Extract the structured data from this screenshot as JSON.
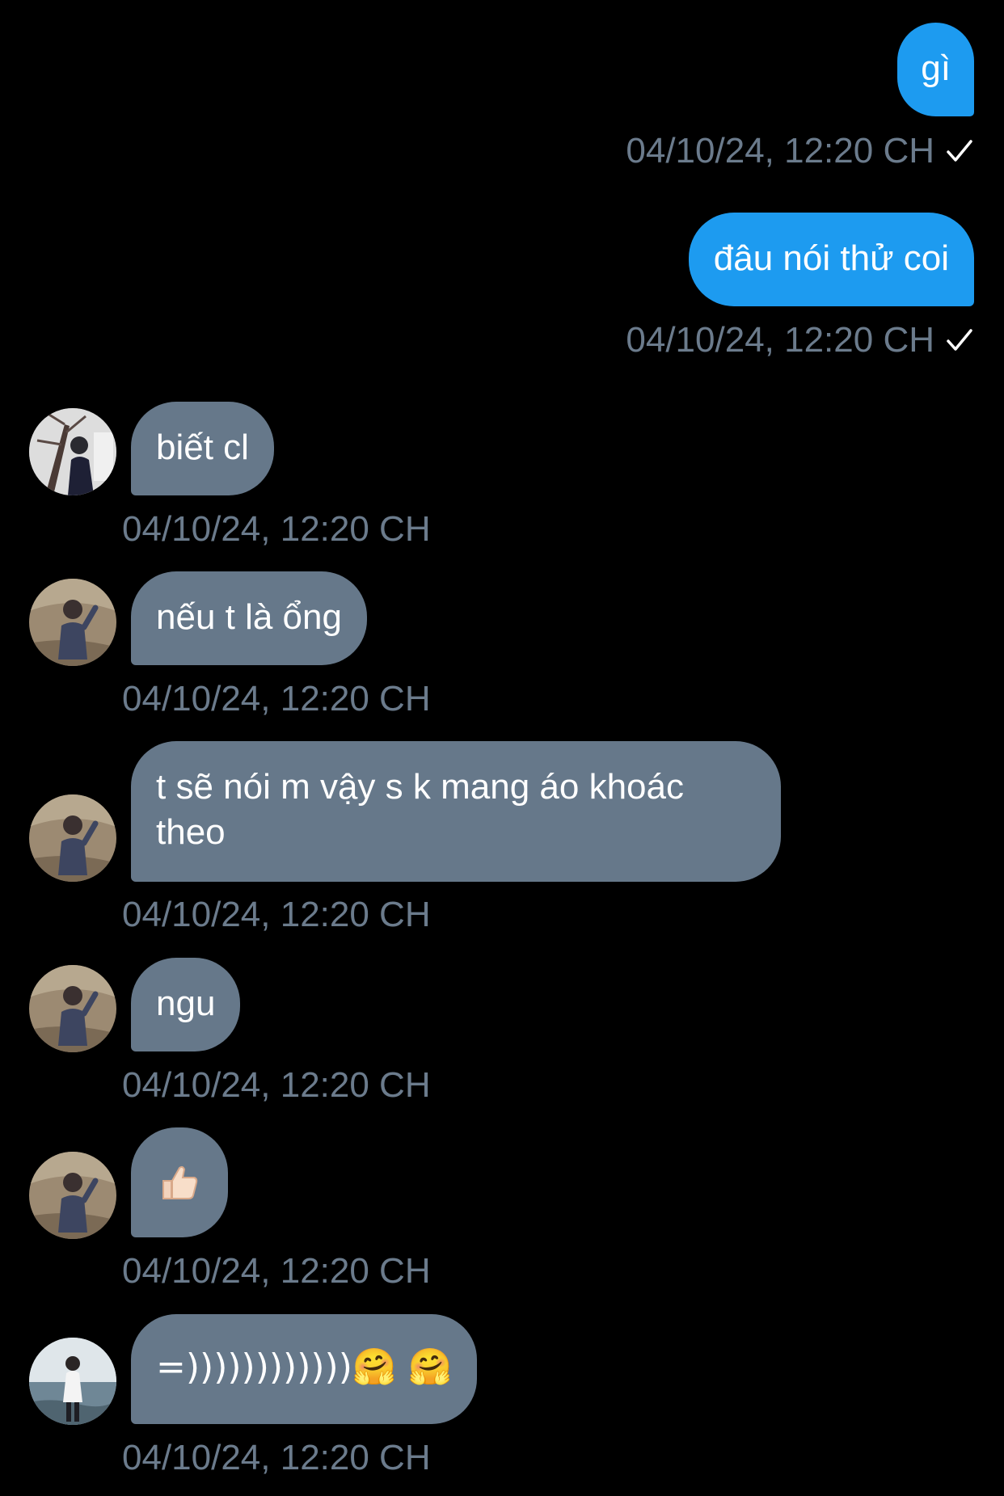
{
  "colors": {
    "background": "#000000",
    "outgoing_bubble": "#1d9bf0",
    "incoming_bubble": "#66788a",
    "timestamp": "#6b7b8c",
    "check": "#ffffff"
  },
  "messages": [
    {
      "direction": "outgoing",
      "text": "gì",
      "timestamp": "04/10/24, 12:20 CH",
      "status_icon": "check-icon"
    },
    {
      "direction": "outgoing",
      "text": "đâu nói thử coi",
      "timestamp": "04/10/24, 12:20 CH",
      "status_icon": "check-icon"
    },
    {
      "direction": "incoming",
      "text": "biết cl",
      "timestamp": "04/10/24, 12:20 CH",
      "avatar": "avatar-photo-tree"
    },
    {
      "direction": "incoming",
      "text": "nếu t là ổng",
      "timestamp": "04/10/24, 12:20 CH",
      "avatar": "avatar-photo-wave"
    },
    {
      "direction": "incoming",
      "text": "t sẽ nói m vậy s k mang áo khoác theo",
      "timestamp": "04/10/24, 12:20 CH",
      "avatar": "avatar-photo-wave"
    },
    {
      "direction": "incoming",
      "text": "ngu",
      "timestamp": "04/10/24, 12:20 CH",
      "avatar": "avatar-photo-wave"
    },
    {
      "direction": "incoming",
      "text": "👍🏻",
      "timestamp": "04/10/24, 12:20 CH",
      "avatar": "avatar-photo-wave"
    },
    {
      "direction": "incoming",
      "text": "=))))))))))))🤗 🤗",
      "timestamp": "04/10/24, 12:20 CH",
      "avatar": "avatar-photo-sea"
    }
  ]
}
